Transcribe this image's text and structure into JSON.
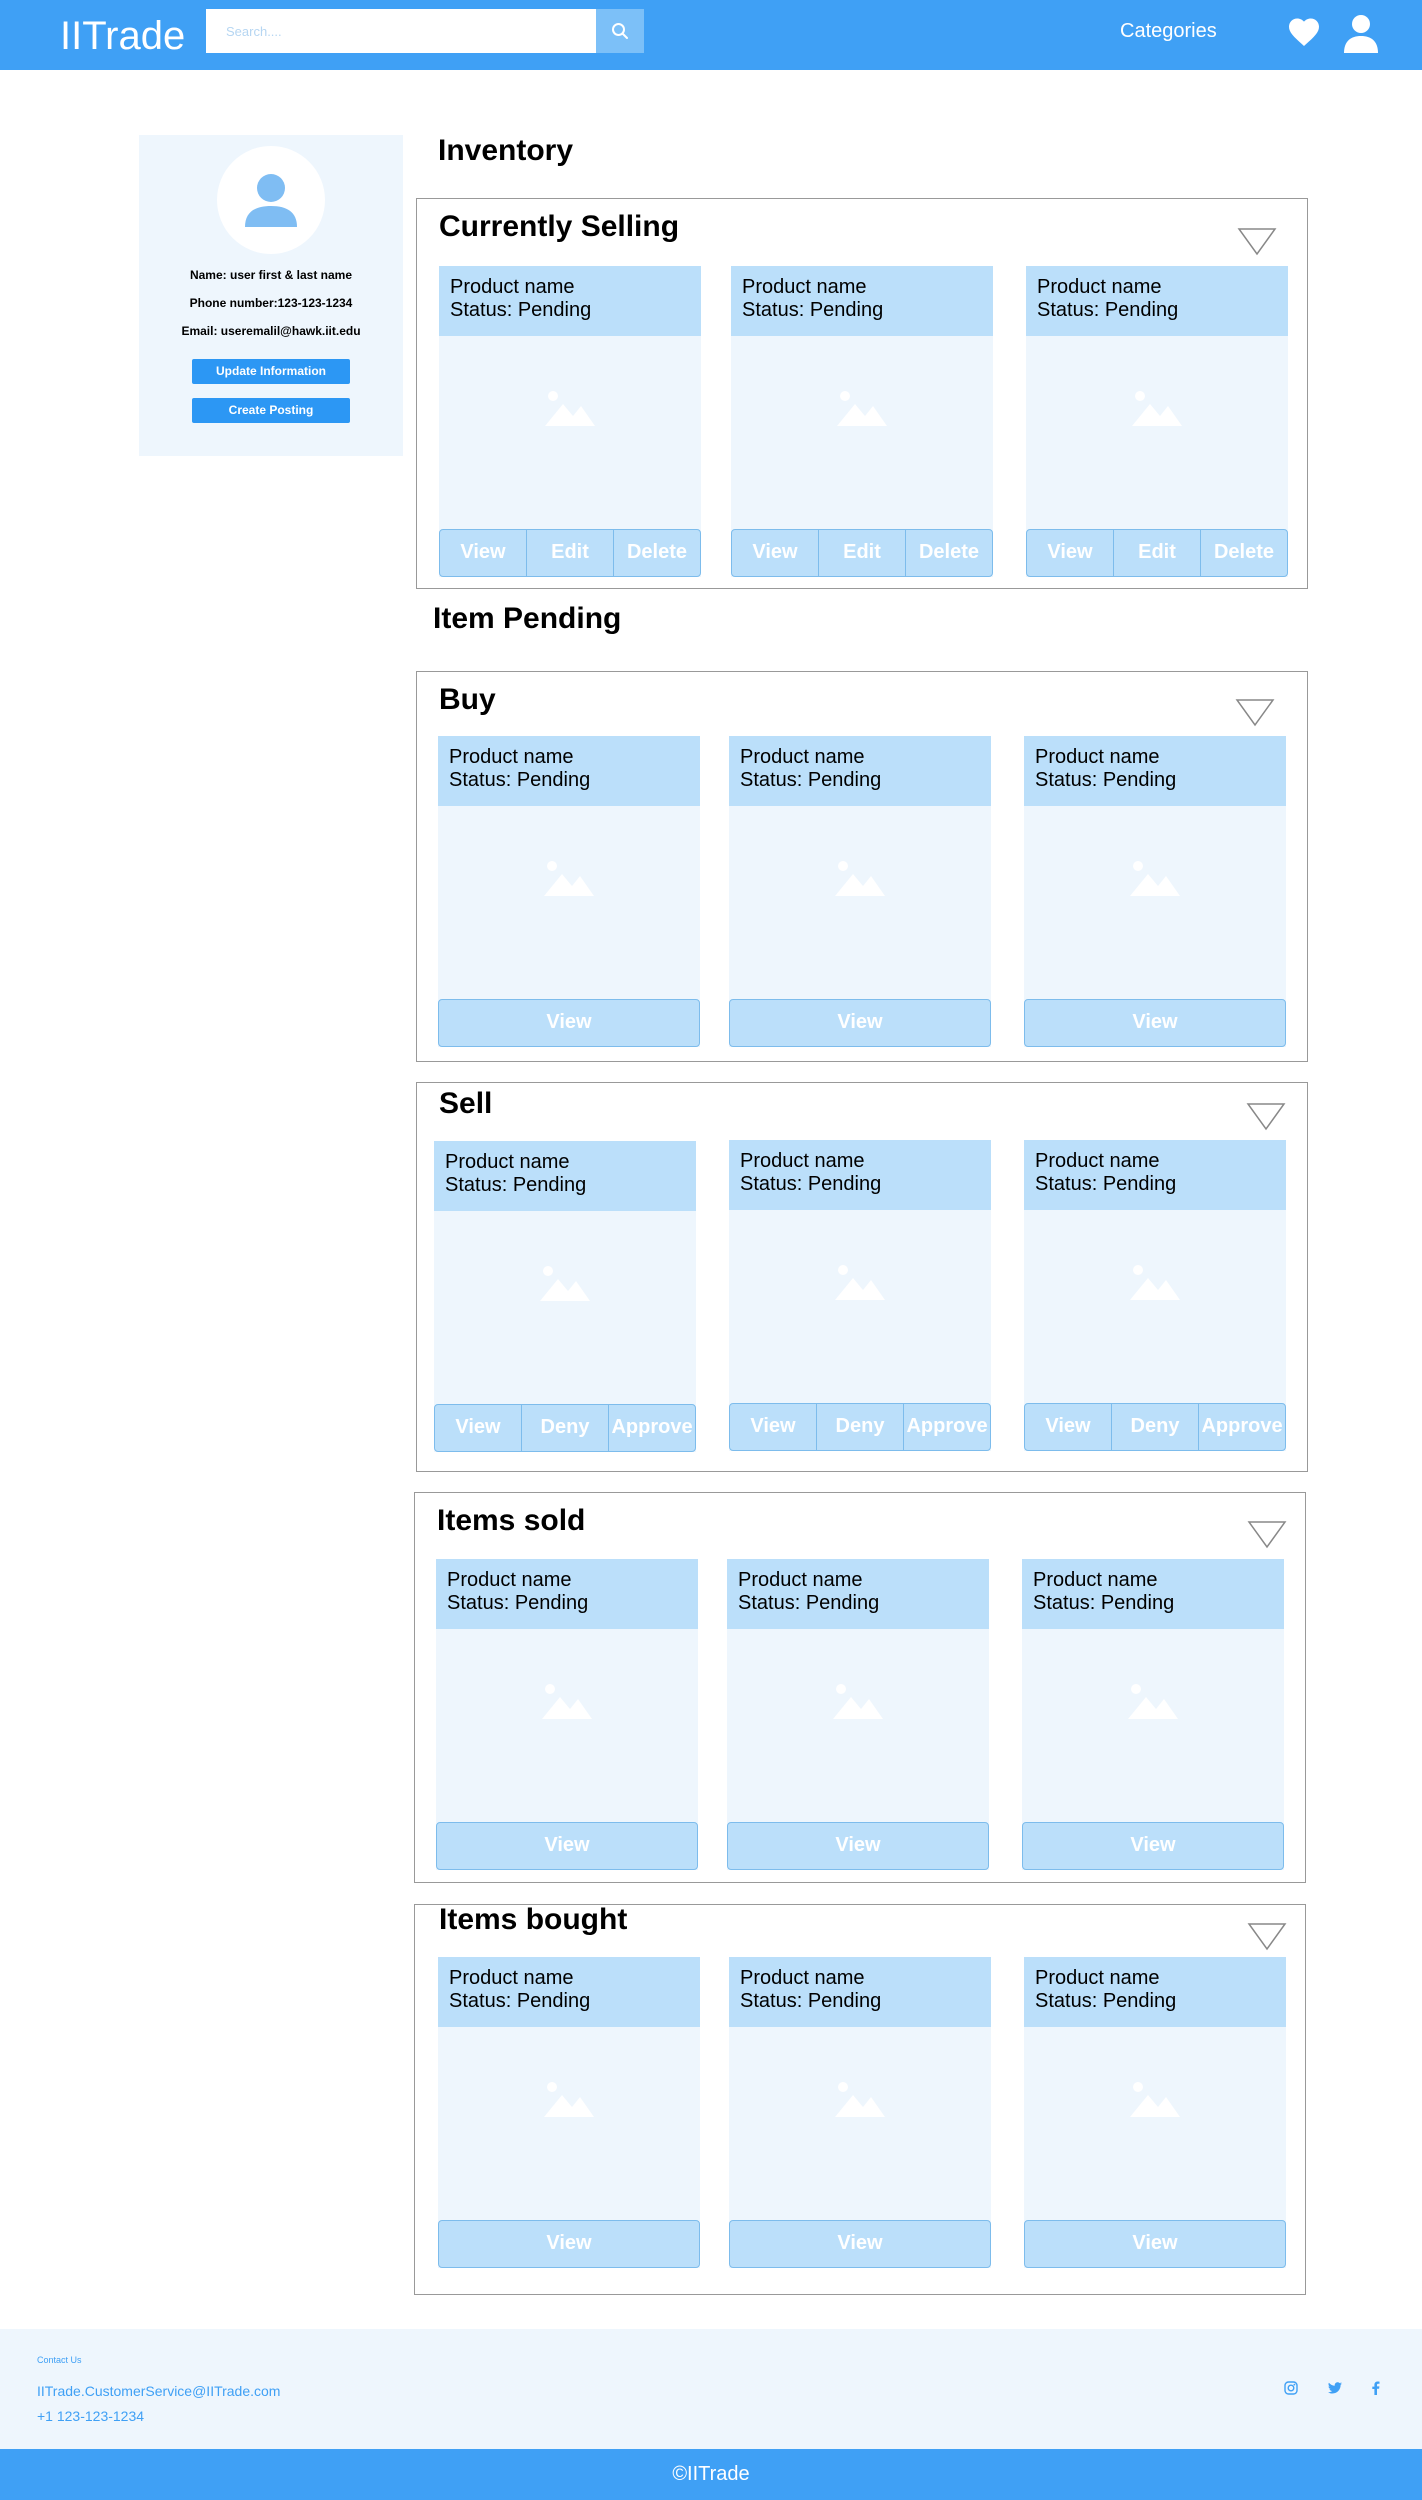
{
  "header": {
    "logo": "IITrade",
    "search_placeholder": "Search....",
    "categories_label": "Categories"
  },
  "profile": {
    "name": "Name: user first & last name",
    "phone": "Phone number:123-123-1234",
    "email": "Email: useremalil@hawk.iit.edu",
    "update_label": "Update Information",
    "create_label": "Create Posting"
  },
  "headings": {
    "inventory": "Inventory",
    "item_pending": "Item Pending"
  },
  "panels": [
    {
      "title": "Currently Selling",
      "cards": [
        {
          "name": "Product name",
          "status": "Status: Pending",
          "actions": [
            "View",
            "Edit",
            "Delete"
          ]
        },
        {
          "name": "Product name",
          "status": "Status: Pending",
          "actions": [
            "View",
            "Edit",
            "Delete"
          ]
        },
        {
          "name": "Product name",
          "status": "Status: Pending",
          "actions": [
            "View",
            "Edit",
            "Delete"
          ]
        }
      ]
    },
    {
      "title": "Buy",
      "cards": [
        {
          "name": "Product name",
          "status": "Status: Pending",
          "actions": [
            "View"
          ]
        },
        {
          "name": "Product name",
          "status": "Status: Pending",
          "actions": [
            "View"
          ]
        },
        {
          "name": "Product name",
          "status": "Status: Pending",
          "actions": [
            "View"
          ]
        }
      ]
    },
    {
      "title": "Sell",
      "cards": [
        {
          "name": "Product name",
          "status": "Status: Pending",
          "actions": [
            "View",
            "Deny",
            "Approve"
          ]
        },
        {
          "name": "Product name",
          "status": "Status: Pending",
          "actions": [
            "View",
            "Deny",
            "Approve"
          ]
        },
        {
          "name": "Product name",
          "status": "Status: Pending",
          "actions": [
            "View",
            "Deny",
            "Approve"
          ]
        }
      ]
    },
    {
      "title": "Items sold",
      "cards": [
        {
          "name": "Product name",
          "status": "Status: Pending",
          "actions": [
            "View"
          ]
        },
        {
          "name": "Product name",
          "status": "Status: Pending",
          "actions": [
            "View"
          ]
        },
        {
          "name": "Product name",
          "status": "Status: Pending",
          "actions": [
            "View"
          ]
        }
      ]
    },
    {
      "title": "Items bought",
      "cards": [
        {
          "name": "Product name",
          "status": "Status: Pending",
          "actions": [
            "View"
          ]
        },
        {
          "name": "Product name",
          "status": "Status: Pending",
          "actions": [
            "View"
          ]
        },
        {
          "name": "Product name",
          "status": "Status: Pending",
          "actions": [
            "View"
          ]
        }
      ]
    }
  ],
  "footer": {
    "contact_heading": "Contact Us",
    "email": "IITrade.CustomerService@IITrade.com",
    "phone": "+1 123-123-1234",
    "social": [
      "instagram-icon",
      "twitter-icon",
      "facebook-icon"
    ],
    "copyright": "©IITrade"
  },
  "colors": {
    "primary": "#3fa0f5",
    "button_blue": "#2c97f4",
    "card_header": "#bbdffa",
    "card_body": "#eef6fd"
  }
}
